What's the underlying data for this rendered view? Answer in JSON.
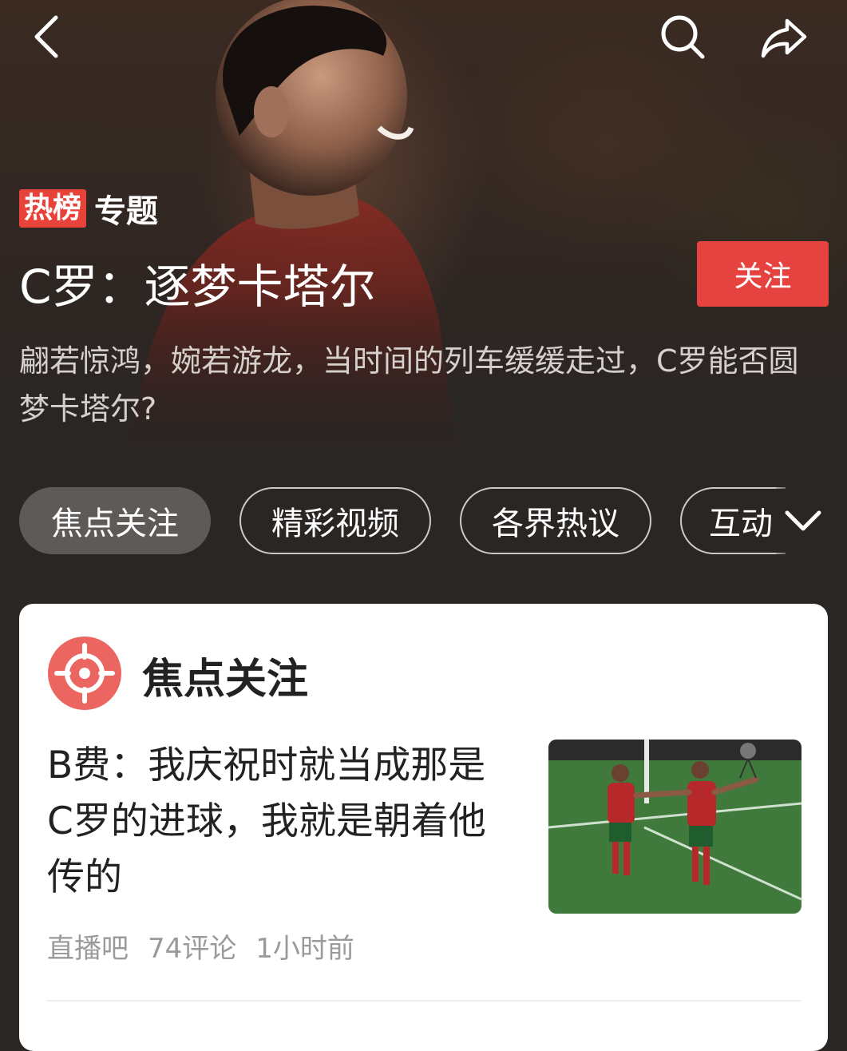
{
  "header": {
    "back_icon": "chevron-left-icon",
    "search_icon": "search-icon",
    "share_icon": "share-icon"
  },
  "topic": {
    "tag_hot": "热榜",
    "tag_topic": "专题",
    "title": "C罗：逐梦卡塔尔",
    "follow_label": "关注",
    "description": "翩若惊鸿，婉若游龙，当时间的列车缓缓走过，C罗能否圆梦卡塔尔?"
  },
  "tabs": [
    {
      "label": "焦点关注",
      "active": true
    },
    {
      "label": "精彩视频",
      "active": false
    },
    {
      "label": "各界热议",
      "active": false
    },
    {
      "label": "互动",
      "active": false
    }
  ],
  "section": {
    "title": "焦点关注",
    "icon": "target-icon"
  },
  "news": [
    {
      "title": "B费：我庆祝时就当成那是C罗的进球，我就是朝着他传的",
      "source": "直播吧",
      "comments": "74评论",
      "time": "1小时前"
    }
  ],
  "colors": {
    "accent": "#e64340",
    "hot_tag": "#e8433b",
    "background": "#2a2624"
  }
}
